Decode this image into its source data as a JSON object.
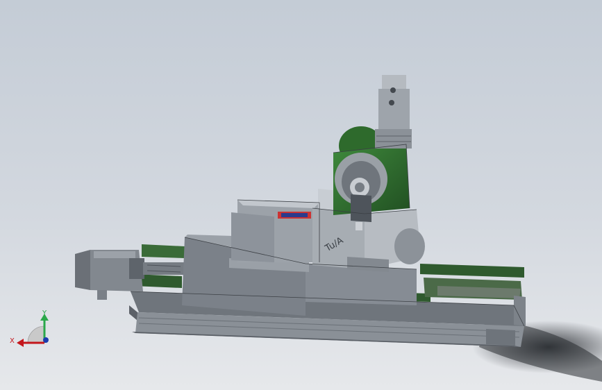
{
  "viewport": {
    "background_top": "#c4ccd6",
    "background_bottom": "#e6e8eb"
  },
  "model": {
    "body_color": "#8d949c",
    "green_color": "#2e6a2c",
    "plate_logo_text": "Tu/A"
  },
  "triad": {
    "x_label": "X",
    "y_label": "Y",
    "x_color": "#c4161c",
    "y_color": "#2aa84a",
    "z_color": "#1a3bb0"
  }
}
